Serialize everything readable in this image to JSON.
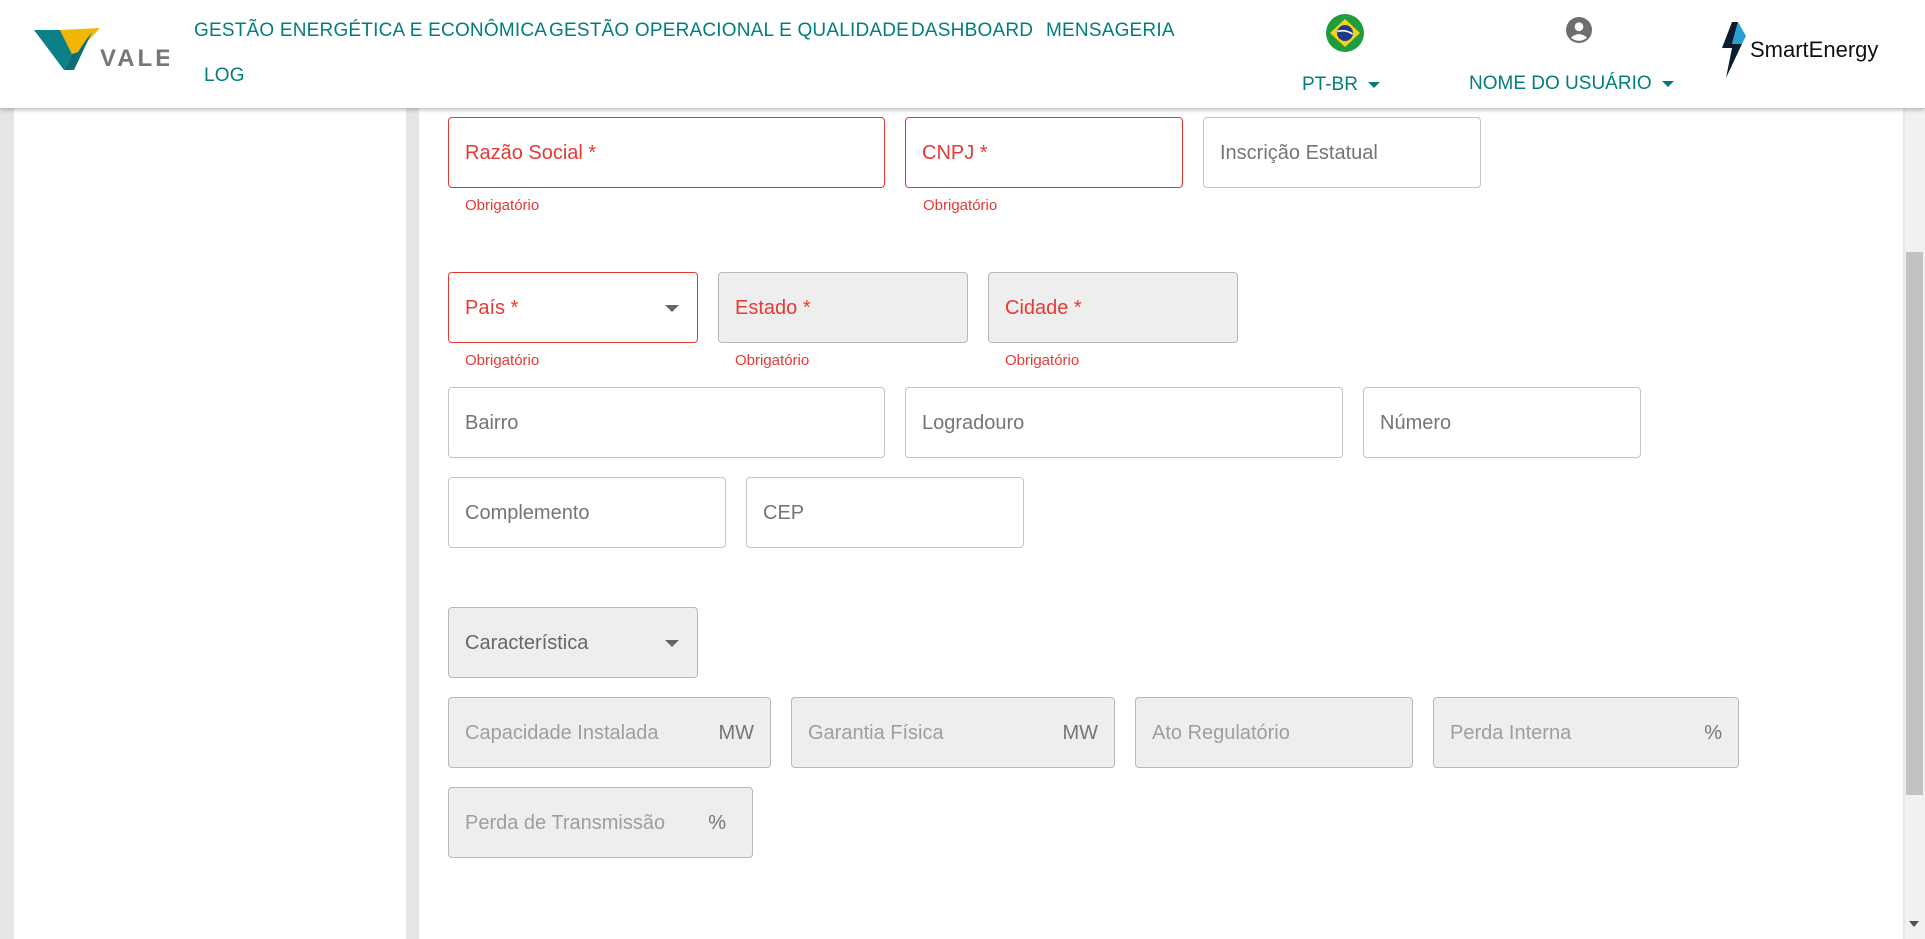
{
  "brand": {
    "vale_text": "VALE",
    "smart_text": "SmartEnergy",
    "accent": "#007e7a"
  },
  "nav": {
    "items": [
      "GESTÃO ENERGÉTICA E ECONÔMICA",
      "GESTÃO OPERACIONAL E QUALIDADE",
      "DASHBOARD",
      "MENSAGERIA",
      "LOG"
    ]
  },
  "language": {
    "label": "PT-BR",
    "flag_icon": "brazil-flag-icon"
  },
  "user": {
    "label": "NOME DO USUÁRIO",
    "icon": "account-circle-icon"
  },
  "form": {
    "razao_social": "Razão Social *",
    "cnpj": "CNPJ *",
    "inscricao_estatual": "Inscrição Estatual",
    "pais": "País *",
    "estado": "Estado *",
    "cidade": "Cidade *",
    "bairro": "Bairro",
    "logradouro": "Logradouro",
    "numero": "Número",
    "complemento": "Complemento",
    "cep": "CEP",
    "caracteristica": "Característica",
    "capacidade_instalada": "Capacidade Instalada",
    "capacidade_unit": "MW",
    "garantia_fisica": "Garantia Física",
    "garantia_unit": "MW",
    "ato_regulatorio": "Ato Regulatório",
    "perda_interna": "Perda Interna",
    "perda_interna_unit": "%",
    "perda_transmissao": "Perda de Transmissão",
    "perda_transmissao_unit": "%",
    "required_helper": "Obrigatório"
  },
  "colors": {
    "error": "#e53935",
    "disabled_bg": "#eeeeee"
  }
}
